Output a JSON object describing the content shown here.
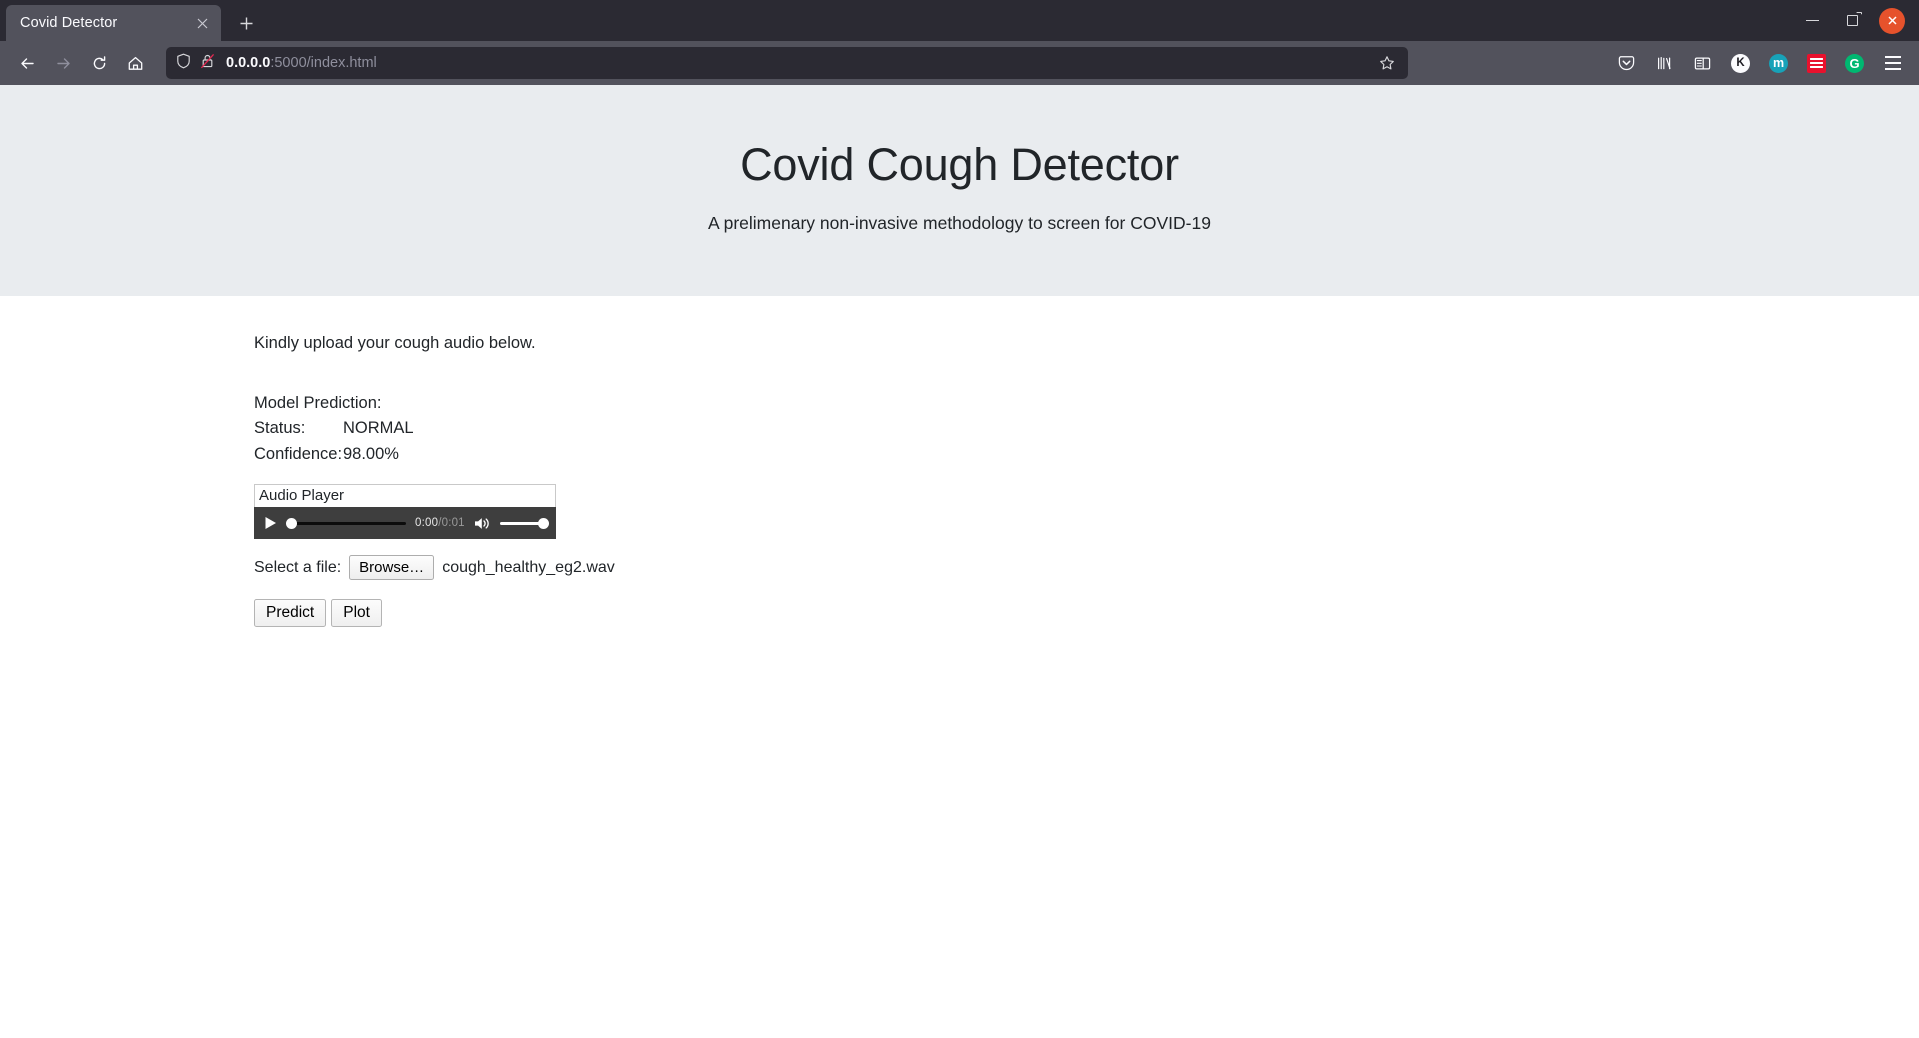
{
  "browser": {
    "tab": {
      "title": "Covid Detector",
      "close_icon": "close-icon"
    },
    "new_tab_label": "+",
    "window_controls": {
      "minimize": "–",
      "maximize": "❐",
      "close": "×"
    },
    "nav": {
      "back": "←",
      "forward": "→",
      "reload": "↻",
      "home": "⌂"
    },
    "url": {
      "host": "0.0.0.0",
      "rest": ":5000/index.html",
      "full": "0.0.0.0:5000/index.html"
    },
    "url_icons": [
      "shield-icon",
      "insecure-lock-icon"
    ],
    "bookmark_icon": "star-icon",
    "toolbar_icons": [
      {
        "name": "pocket-icon",
        "label": ""
      },
      {
        "name": "library-icon",
        "label": ""
      },
      {
        "name": "sidebar-icon",
        "label": ""
      },
      {
        "name": "extension-k-icon",
        "label": "K"
      },
      {
        "name": "extension-m-icon",
        "label": "m"
      },
      {
        "name": "extension-red-icon",
        "label": ""
      },
      {
        "name": "extension-g-icon",
        "label": "G"
      },
      {
        "name": "app-menu-icon",
        "label": ""
      }
    ]
  },
  "page": {
    "title": "Covid Cough Detector",
    "subtitle": "A prelimenary non-invasive methodology to screen for COVID-19",
    "lead": "Kindly upload your cough audio below.",
    "prediction": {
      "heading": "Model Prediction:",
      "status_label": "Status:",
      "status_value": "NORMAL",
      "confidence_label": "Confidence:",
      "confidence_value": "98.00%"
    },
    "audio": {
      "label": "Audio Player",
      "current_time": "0:00",
      "separator": "/",
      "duration": "0:01",
      "play_icon": "play-icon",
      "volume_icon": "volume-high-icon"
    },
    "file": {
      "label": "Select a file:",
      "browse_label": "Browse…",
      "file_name": "cough_healthy_eg2.wav"
    },
    "actions": {
      "predict_label": "Predict",
      "plot_label": "Plot"
    }
  },
  "colors": {
    "chrome_tabstrip": "#2b2a33",
    "chrome_navbar": "#52525c",
    "jumbotron": "#e9ecef",
    "text": "#212529",
    "player_bg": "#3e3e3e",
    "close_button": "#e6522c"
  }
}
